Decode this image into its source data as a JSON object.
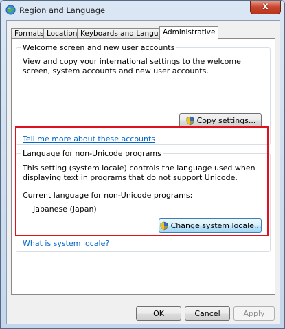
{
  "window": {
    "title": "Region and Language",
    "close_glyph": "x"
  },
  "tabs": [
    {
      "label": "Formats",
      "active": false
    },
    {
      "label": "Location",
      "active": false
    },
    {
      "label": "Keyboards and Languages",
      "active": false
    },
    {
      "label": "Administrative",
      "active": true
    }
  ],
  "welcome_group": {
    "legend": "Welcome screen and new user accounts",
    "description": "View and copy your international settings to the welcome screen, system accounts and new user accounts.",
    "copy_button": "Copy settings...",
    "help_link": "Tell me more about these accounts"
  },
  "nonunicode_group": {
    "legend": "Language for non-Unicode programs",
    "description": "This setting (system locale) controls the language used when displaying text in programs that do not support Unicode.",
    "current_label": "Current language for non-Unicode programs:",
    "current_value": "Japanese (Japan)",
    "change_button": "Change system locale...",
    "help_link": "What is system locale?"
  },
  "footer": {
    "ok": "OK",
    "cancel": "Cancel",
    "apply": "Apply"
  },
  "colors": {
    "highlight": "#e0101c",
    "link": "#0066cc",
    "close_button": "#c7452d"
  },
  "icons": {
    "app": "globe-icon",
    "uac": "shield-icon"
  }
}
